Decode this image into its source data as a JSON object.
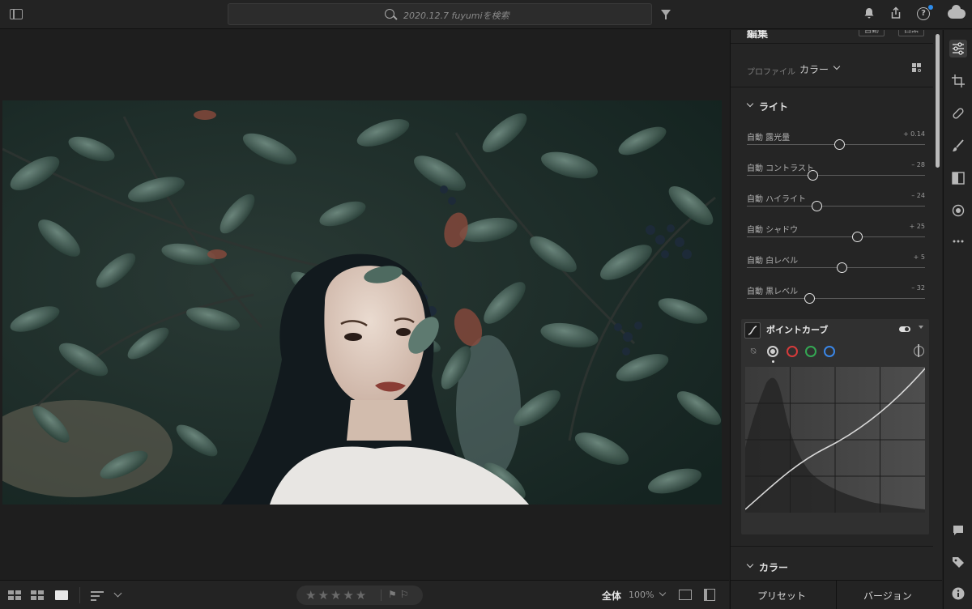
{
  "search": {
    "placeholder": "2020.12.7 fuyumiを検索"
  },
  "panel": {
    "title": "編集",
    "auto_button": "自動",
    "bw_button": "白黒",
    "profile_label": "プロファイル",
    "profile_value": "カラー",
    "light_section": "ライト",
    "sliders": [
      {
        "label": "自動 露光量",
        "value": "+ 0.14",
        "level": 0.52
      },
      {
        "label": "自動 コントラスト",
        "value": "– 28",
        "level": 0.37
      },
      {
        "label": "自動 ハイライト",
        "value": "– 24",
        "level": 0.39
      },
      {
        "label": "自動 シャドウ",
        "value": "+ 25",
        "level": 0.62
      },
      {
        "label": "自動 白レベル",
        "value": "+ 5",
        "level": 0.53
      },
      {
        "label": "自動 黒レベル",
        "value": "– 32",
        "level": 0.35
      }
    ],
    "curve": {
      "title": "ポイントカーブ"
    },
    "color_section": "カラー"
  },
  "footer": {
    "presets": "プリセット",
    "versions": "バージョン"
  },
  "bottombar": {
    "fit": "全体",
    "zoom": "100%"
  },
  "colors": {
    "accent": "#2d8ceb",
    "panel_bg": "#252525",
    "app_bg": "#1e1e1e"
  },
  "icons": [
    "sidebar-toggle-icon",
    "search-icon",
    "filter-icon",
    "bell-icon",
    "share-icon",
    "help-icon",
    "cloud-icon",
    "edit-sliders-icon",
    "crop-icon",
    "healing-icon",
    "brush-icon",
    "linear-gradient-icon",
    "radial-gradient-icon",
    "more-icon",
    "comment-icon",
    "tag-icon",
    "info-icon"
  ]
}
